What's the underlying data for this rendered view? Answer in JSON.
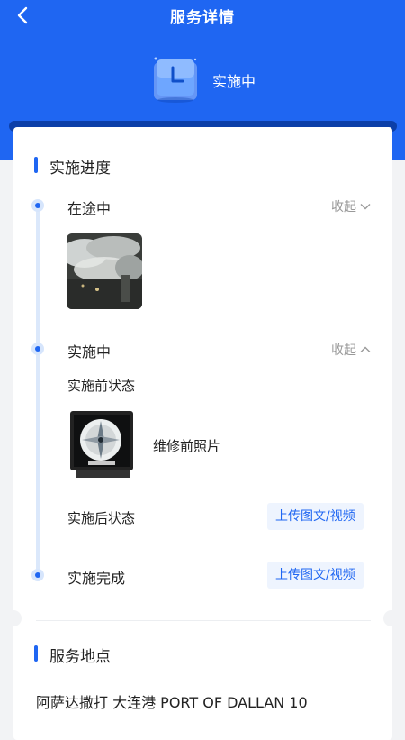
{
  "header": {
    "title": "服务详情",
    "status": "实施中"
  },
  "progress": {
    "section_title": "实施进度",
    "steps": [
      {
        "label": "在途中",
        "toggle": "收起"
      },
      {
        "label": "实施中",
        "toggle": "收起",
        "before_label": "实施前状态",
        "before_photo_caption": "维修前照片",
        "after_label": "实施后状态",
        "upload_label": "上传图文/视频"
      },
      {
        "label": "实施完成",
        "upload_label": "上传图文/视频"
      }
    ]
  },
  "location": {
    "section_title": "服务地点",
    "address": "阿萨达撒打 大连港 PORT OF DALLAN 10"
  },
  "colors": {
    "primary": "#1f66f2",
    "dark_bar": "#0c3fa8",
    "background": "#f2f3f5"
  },
  "icons": [
    "back-arrow-icon",
    "clock-icon",
    "chevron-down-icon",
    "chevron-up-icon"
  ]
}
